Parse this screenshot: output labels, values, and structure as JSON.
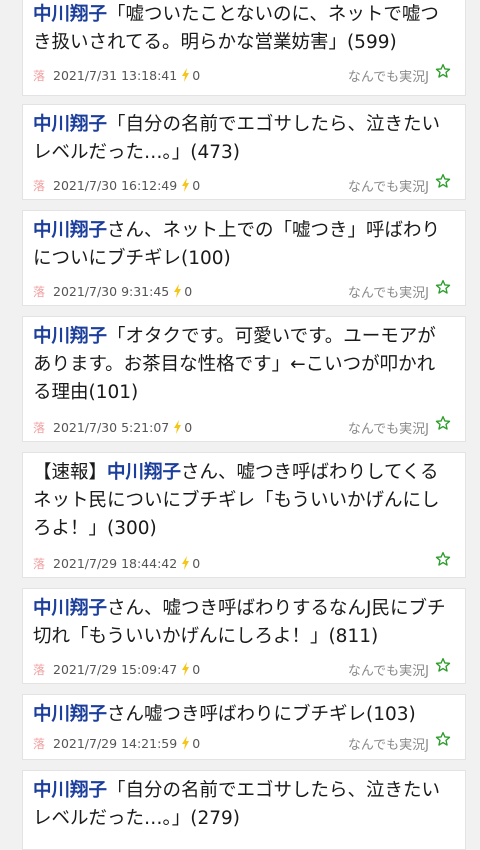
{
  "threads": [
    {
      "prefix": "",
      "name": "中川翔子",
      "title": "「嘘ついたことないのに、ネットで嘘つき扱いされてる。明らかな営業妨害」",
      "count": "(599)",
      "date": "2021/7/31 13:18:41",
      "votes": "0",
      "board": "なんでも実況J",
      "ochi": "落"
    },
    {
      "prefix": "",
      "name": "中川翔子",
      "title": "「自分の名前でエゴサしたら、泣きたいレベルだった…。」",
      "count": "(473)",
      "date": "2021/7/30 16:12:49",
      "votes": "0",
      "board": "なんでも実況J",
      "ochi": "落"
    },
    {
      "prefix": "",
      "name": "中川翔子",
      "title": "さん、ネット上での「嘘つき」呼ばわりについにブチギレ",
      "count": "(100)",
      "date": "2021/7/30 9:31:45",
      "votes": "0",
      "board": "なんでも実況J",
      "ochi": "落"
    },
    {
      "prefix": "",
      "name": "中川翔子",
      "title": "「オタクです。可愛いです。ユーモアがあります。お茶目な性格です」←こいつが叩かれる理由",
      "count": "(101)",
      "date": "2021/7/30 5:21:07",
      "votes": "0",
      "board": "なんでも実況J",
      "ochi": "落"
    },
    {
      "prefix": "【速報】",
      "name": "中川翔子",
      "title": "さん、嘘つき呼ばわりしてくるネット民についにブチギレ「もういいかげんにしろよ！」",
      "count": "(300)",
      "date": "2021/7/29 18:44:42",
      "votes": "0",
      "board": "",
      "ochi": "落"
    },
    {
      "prefix": "",
      "name": "中川翔子",
      "title": "さん、嘘つき呼ばわりするなんJ民にブチ切れ「もういいかげんにしろよ！」",
      "count": "(811)",
      "date": "2021/7/29 15:09:47",
      "votes": "0",
      "board": "なんでも実況J",
      "ochi": "落"
    },
    {
      "prefix": "",
      "name": "中川翔子",
      "title": "さん嘘つき呼ばわりにブチギレ",
      "count": "(103)",
      "date": "2021/7/29 14:21:59",
      "votes": "0",
      "board": "なんでも実況J",
      "ochi": "落"
    },
    {
      "prefix": "",
      "name": "中川翔子",
      "title": "「自分の名前でエゴサしたら、泣きたいレベルだった…。」",
      "count": "(279)",
      "date": "",
      "votes": "",
      "board": "",
      "ochi": ""
    }
  ],
  "colors": {
    "accent": "#1d3f9c",
    "bolt": "#f5c518",
    "star": "#2a9d2a",
    "ochi": "#f0a0a0"
  },
  "icons": {
    "bolt": "lightning-bolt-icon",
    "star": "star-outline-icon"
  }
}
